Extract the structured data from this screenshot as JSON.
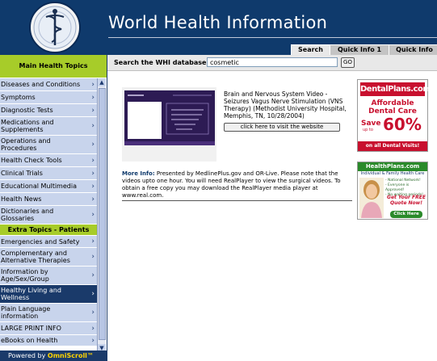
{
  "header": {
    "title": "World Health Information",
    "tabs": [
      {
        "label": "Search",
        "active": true
      },
      {
        "label": "Quick Info 1",
        "active": false
      },
      {
        "label": "Quick Info",
        "active": false
      }
    ]
  },
  "sidebar": {
    "main_topics_label": "Main Health Topics",
    "items": [
      {
        "label": "Diseases and Conditions"
      },
      {
        "label": "Symptoms"
      },
      {
        "label": "Diagnostic Tests"
      },
      {
        "label": "Medications and Supplements"
      },
      {
        "label": "Operations and Procedures"
      },
      {
        "label": "Health Check Tools"
      },
      {
        "label": "Clinical Trials"
      },
      {
        "label": "Educational Multimedia"
      },
      {
        "label": "Health News"
      },
      {
        "label": "Dictionaries and Glossaries"
      }
    ],
    "extra_topics_label": "Extra Topics - Patients",
    "extra_items": [
      {
        "label": "Emergencies and Safety"
      },
      {
        "label": "Complementary and Alternative Therapies"
      },
      {
        "label": "Information by Age/Sex/Group"
      },
      {
        "label": "Healthy Living and Wellness"
      },
      {
        "label": "Plain Language information"
      },
      {
        "label": "LARGE PRINT INFO"
      },
      {
        "label": "eBooks on Health"
      }
    ],
    "powered_prefix": "Powered by ",
    "powered_brand": "OmniScroll™"
  },
  "search": {
    "label": "Search the WHI database:",
    "value": "cosmetic",
    "go_label": "GO"
  },
  "result": {
    "description": "Brain and Nervous System Video - Seizures Vagus Nerve Stimulation (VNS Therapy) (Methodist University Hospital, Memphis, TN, 10/28/2004)",
    "visit_button": "click here to visit the website",
    "more_info_label": "More Info:",
    "more_info_text": " Presented by MedlinePlus.gov and OR-Live. Please note that the videos upto one hour. You will need RealPlayer to view the surgical videos. To obtain a free copy you may download the RealPlayer media player at www.real.com."
  },
  "ads": {
    "dental": {
      "brand": "DentalPlans.com",
      "line1": "Affordable",
      "line2": "Dental Care",
      "save_prefix": "Save",
      "save_upto": "up to",
      "save_percent": "60%",
      "line3": "on all Dental Visits!"
    },
    "health": {
      "brand": "HealthPlans.com",
      "subtitle": "Individual & Family Health Care",
      "bullets": [
        "- National Network!",
        "- Everyone is Approved!",
        "- No waiting periods!"
      ],
      "quote": "Get Your FREE Quote Now!",
      "button": "Click Here"
    }
  },
  "colors": {
    "header_bg": "#0f3a6c",
    "green_accent": "#a7cc29",
    "menu_bg": "#c8d4ec",
    "menu_selected": "#1a3a6a",
    "dental_red": "#c8102e",
    "health_green": "#2a8a2a"
  }
}
